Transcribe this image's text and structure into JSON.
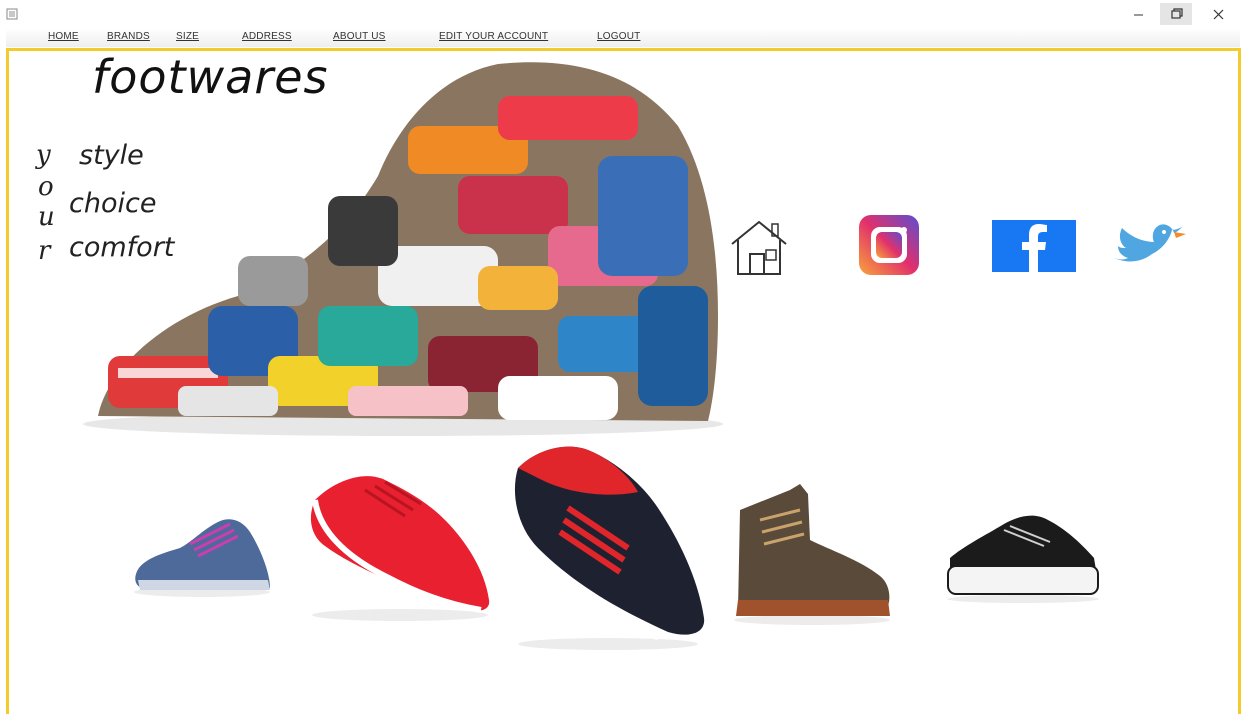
{
  "menu": {
    "home": "HOME",
    "brands": "BRANDS",
    "size": "SIZE",
    "address": "ADDRESS",
    "about": "ABOUT US",
    "edit_account": "EDIT YOUR ACCOUNT",
    "logout": "LOGOUT"
  },
  "brand": {
    "title": "footwares"
  },
  "vertical_word": [
    "y",
    "o",
    "u",
    "r"
  ],
  "taglines": [
    "style",
    "choice",
    "comfort"
  ],
  "window_controls": {
    "minimize": "–",
    "close": "✕"
  },
  "colors": {
    "frame_border": "#f2cc2e",
    "facebook": "#1877f2",
    "twitter": "#4fa6e0"
  }
}
